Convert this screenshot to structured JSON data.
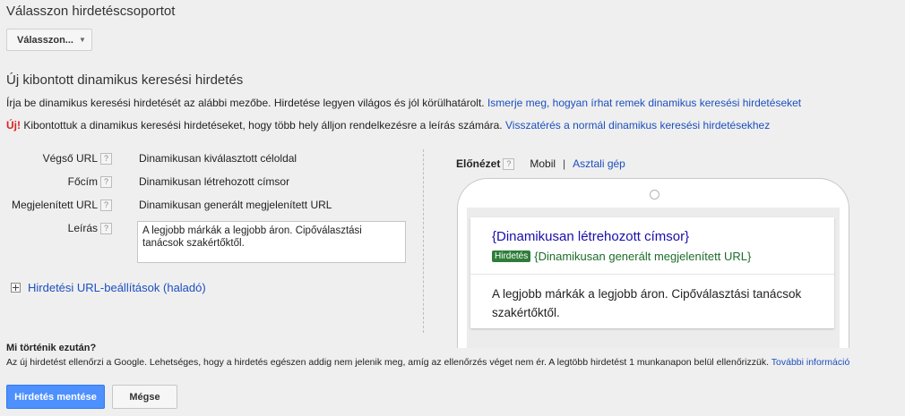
{
  "adgroup": {
    "heading": "Válasszon hirdetéscsoportot",
    "select_label": "Válasszon..."
  },
  "form": {
    "heading": "Új kibontott dinamikus keresési hirdetés",
    "intro_text": "Írja be dinamikus keresési hirdetését az alábbi mezőbe. Hirdetése legyen világos és jól körülhatárolt.",
    "intro_link": "Ismerje meg, hogyan írhat remek dinamikus keresési hirdetéseket",
    "new_badge": "Új!",
    "new_text": "Kibontottuk a dinamikus keresési hirdetéseket, hogy több hely álljon rendelkezésre a leírás számára.",
    "new_link": "Visszatérés a normál dinamikus keresési hirdetésekhez",
    "help_mark": "?",
    "fields": {
      "final_url_label": "Végső URL",
      "final_url_value": "Dinamikusan kiválasztott céloldal",
      "headline_label": "Főcím",
      "headline_value": "Dinamikusan létrehozott címsor",
      "display_url_label": "Megjelenített URL",
      "display_url_value": "Dinamikusan generált megjelenített URL",
      "description_label": "Leírás",
      "description_value": "A legjobb márkák a legjobb áron. Cipőválasztási tanácsok szakértőktől."
    },
    "advanced_link": "Hirdetési URL-beállítások (haladó)"
  },
  "preview": {
    "label": "Előnézet",
    "tab_mobile": "Mobil",
    "separator": "|",
    "tab_desktop": "Asztali gép",
    "ad_title": "{Dinamikusan létrehozott címsor}",
    "ad_badge": "Hirdetés",
    "ad_url": "{Dinamikusan generált megjelenített URL}",
    "ad_description": "A legjobb márkák a legjobb áron. Cipőválasztási tanácsok szakértőktől."
  },
  "info": {
    "title": "Mi történik ezután?",
    "text": "Az új hirdetést ellenőrzi a Google. Lehetséges, hogy a hirdetés egészen addig nem jelenik meg, amíg az ellenőrzés véget nem ér. A legtöbb hirdetést 1 munkanapon belül ellenőrizzük.",
    "link": "További információ"
  },
  "buttons": {
    "save": "Hirdetés mentése",
    "cancel": "Mégse"
  },
  "colors": {
    "link": "#1c4fbf",
    "primary_button": "#4d90fe",
    "new_badge": "#dd2222",
    "ad_badge": "#2f7d3a"
  }
}
